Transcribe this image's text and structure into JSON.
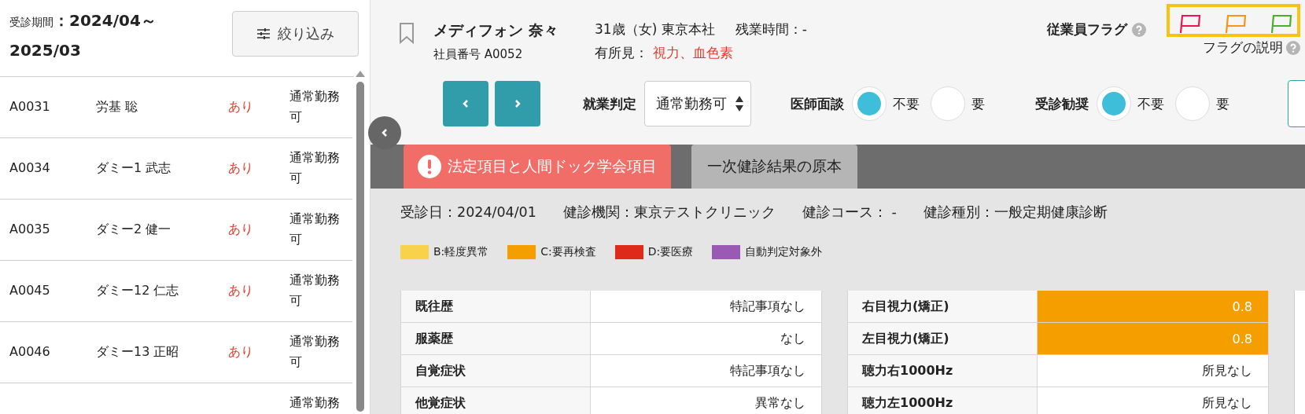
{
  "sidebar": {
    "period_label": "受診期間",
    "period_value": "：2024/04～2025/03",
    "filter_button": "絞り込み",
    "rows": [
      {
        "id": "A0031",
        "name": "労基 聡",
        "finding": "あり",
        "judgement": "通常勤務可"
      },
      {
        "id": "A0034",
        "name": "ダミー1 武志",
        "finding": "あり",
        "judgement": "通常勤務可"
      },
      {
        "id": "A0035",
        "name": "ダミー2 健一",
        "finding": "あり",
        "judgement": "通常勤務可"
      },
      {
        "id": "A0045",
        "name": "ダミー12 仁志",
        "finding": "あり",
        "judgement": "通常勤務可"
      },
      {
        "id": "A0046",
        "name": "ダミー13 正昭",
        "finding": "あり",
        "judgement": "通常勤務可"
      },
      {
        "judgement": "通常勤務"
      }
    ]
  },
  "employee": {
    "name": "メディフォン 奈々",
    "number": "社員番号 A0052",
    "profile": "31歳（女) 東京本社",
    "overtime": "残業時間：-",
    "findings_label": "有所見：",
    "findings": "視力、血色素"
  },
  "flags": {
    "label": "従業員フラグ",
    "help": "フラグの説明",
    "items": [
      {
        "color": "#e8174f"
      },
      {
        "color": "#f7941d"
      },
      {
        "color": "#4caf2a"
      }
    ]
  },
  "work_judgement": {
    "label": "就業判定",
    "value": "通常勤務可"
  },
  "radio_groups": [
    {
      "label": "医師面談",
      "options": [
        {
          "label": "不要",
          "selected": true
        },
        {
          "label": "要",
          "selected": false
        }
      ]
    },
    {
      "label": "受診勧奨",
      "options": [
        {
          "label": "不要",
          "selected": true
        },
        {
          "label": "要",
          "selected": false
        }
      ]
    }
  ],
  "tabs": [
    {
      "label": "法定項目と人間ドック学会項目",
      "selected": true,
      "alert": true
    },
    {
      "label": "一次健診結果の原本",
      "selected": false,
      "alert": false
    }
  ],
  "exam_info": [
    "受診日：2024/04/01",
    "健診機関：東京テストクリニック",
    "健診コース： -",
    "健診種別：一般定期健康診断"
  ],
  "legend": [
    {
      "label": "B:軽度異常",
      "color": "#f7d24a"
    },
    {
      "label": "C:要再検査",
      "color": "#f59e00"
    },
    {
      "label": "D:要医療",
      "color": "#dd2a1b"
    },
    {
      "label": "自動判定対象外",
      "color": "#9b59b6"
    }
  ],
  "tables": [
    [
      {
        "item": "既往歴",
        "value": "特記事項なし"
      },
      {
        "item": "服薬歴",
        "value": "なし"
      },
      {
        "item": "自覚症状",
        "value": "特記事項なし"
      },
      {
        "item": "他覚症状",
        "value": "異常なし"
      }
    ],
    [
      {
        "item": "右目視力(矯正)",
        "value": "0.8",
        "color": "#f59e00"
      },
      {
        "item": "左目視力(矯正)",
        "value": "0.8",
        "color": "#f59e00"
      },
      {
        "item": "聴力右1000Hz",
        "value": "所見なし"
      },
      {
        "item": "聴力左1000Hz",
        "value": "所見なし"
      }
    ]
  ]
}
